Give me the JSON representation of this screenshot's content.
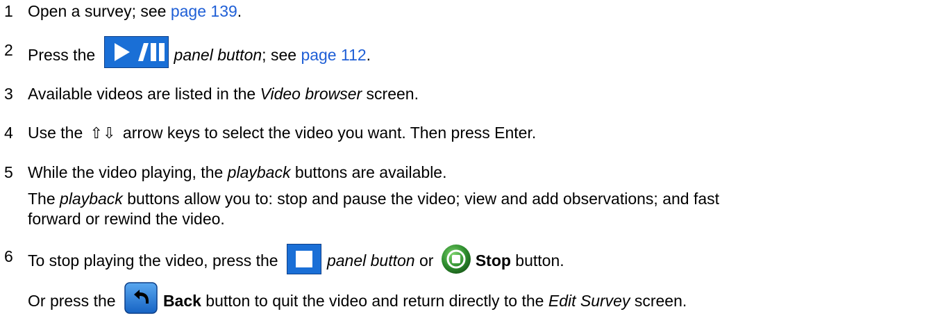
{
  "steps": [
    {
      "num": "1",
      "pre": "Open a survey; see ",
      "link": "page 139",
      "post": "."
    },
    {
      "num": "2",
      "pre": "Press the ",
      "icon": "play-pause-panel-icon",
      "italic": "panel button",
      "mid": "; see ",
      "link": "page 112",
      "post": "."
    },
    {
      "num": "3",
      "pre": "Available videos are listed in the ",
      "italic": "Video browser",
      "post": " screen."
    },
    {
      "num": "4",
      "pre": "Use the ",
      "arrows": "⇧⇩",
      "post": " arrow keys to select the video you want. Then press Enter."
    },
    {
      "num": "5",
      "pre": "While the video playing, the ",
      "italic": "playback",
      "post": " buttons are available.",
      "para_italic": "playback",
      "para_pre": "The ",
      "para_post": " buttons allow you to: stop and pause the video; view and add observations; and fast",
      "para_line2": "forward or rewind the video."
    },
    {
      "num": "6",
      "pre": "To stop playing the video, press the ",
      "italic": "panel button",
      "mid": " or ",
      "bold": "Stop",
      "post": " button.",
      "para_pre": "Or press the ",
      "para_bold": "Back",
      "para_post": " button to quit the video and return directly to the ",
      "para_italic": "Edit Survey",
      "para_end": " screen."
    }
  ],
  "icons": {
    "panel_color": "#1a6fd6",
    "link_color": "#1f5fd6"
  }
}
